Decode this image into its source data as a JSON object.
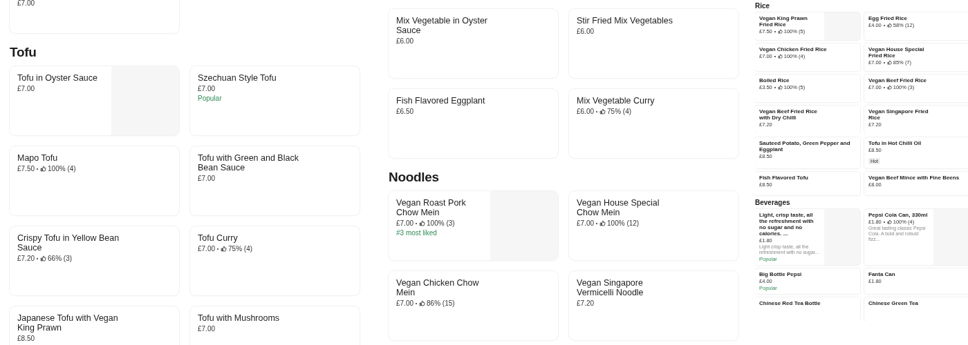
{
  "panels": [
    {
      "kind": "large",
      "scrolled": true,
      "sections": [
        {
          "items": [
            {
              "price": "£7.00"
            }
          ]
        },
        {
          "heading": "Tofu",
          "items": [
            {
              "name": "Tofu in Oyster Sauce",
              "price": "£7.00",
              "image": true
            },
            {
              "name": "Szechuan Style Tofu",
              "price": "£7.00",
              "tag": {
                "text": "Popular",
                "kind": "label"
              }
            },
            {
              "name": "Mapo Tofu",
              "price": "£7.50",
              "rating": "100% (4)"
            },
            {
              "name": "Tofu with Green and Black Bean Sauce",
              "price": "£7.00"
            },
            {
              "name": "Crispy Tofu in Yellow Bean Sauce",
              "price": "£7.20",
              "rating": "66% (3)"
            },
            {
              "name": "Tofu Curry",
              "price": "£7.00",
              "rating": "75% (4)"
            },
            {
              "name": "Japanese Tofu with Vegan King Prawn",
              "price": "£8.50"
            },
            {
              "name": "Tofu with Mushrooms",
              "price": "£7.00"
            }
          ]
        }
      ]
    },
    {
      "kind": "large",
      "sections": [
        {
          "items": [
            {
              "name": "Mix Vegetable in Oyster Sauce",
              "price": "£6.00"
            },
            {
              "name": "Stir Fried Mix Vegetables",
              "price": "£6.00"
            },
            {
              "name": "Fish Flavored Eggplant",
              "price": "£6.50"
            },
            {
              "name": "Mix Vegetable Curry",
              "price": "£6.00",
              "rating": "75% (4)"
            }
          ]
        },
        {
          "heading": "Noodles",
          "items": [
            {
              "name": "Vegan Roast Pork Chow Mein",
              "price": "£7.00",
              "rating": "100% (3)",
              "tag": {
                "text": "#3 most liked",
                "kind": "label"
              },
              "image": true
            },
            {
              "name": "Vegan House Special Chow Mein",
              "price": "£7.00",
              "rating": "100% (12)"
            },
            {
              "name": "Vegan Chicken Chow Mein",
              "price": "£7.00",
              "rating": "86% (15)"
            },
            {
              "name": "Vegan Singapore Vermicelli Noodle",
              "price": "£7.20"
            }
          ]
        }
      ]
    },
    {
      "kind": "small",
      "sections": [
        {
          "heading": "Rice",
          "items": [
            {
              "name": "Vegan King Prawn Fried Rice",
              "price": "£7.50",
              "rating": "100% (5)",
              "image": true
            },
            {
              "name": "Egg Fried Rice",
              "price": "£4.00",
              "rating": "58% (12)"
            },
            {
              "name": "Vegan Chicken Fried Rice",
              "price": "£7.00",
              "rating": "100% (4)"
            },
            {
              "name": "Vegan House Special Fried Rice",
              "price": "£7.00",
              "rating": "85% (7)"
            },
            {
              "name": "Boiled Rice",
              "price": "£3.50",
              "rating": "100% (5)"
            },
            {
              "name": "Vegan Beef Fried Rice",
              "price": "£7.00",
              "rating": "100% (3)"
            },
            {
              "name": "Vegan Beef Fried Rice with Dry Chilli",
              "price": "£7.20"
            },
            {
              "name": "Vegan Singapore Fried Rice",
              "price": "£7.20"
            }
          ]
        }
      ]
    },
    {
      "kind": "tiny",
      "sections": [
        {
          "items": [
            {
              "name": "Sauteed Potato, Green Pepper and Eggplant",
              "price": "£8.50"
            },
            {
              "name": "Tofu in Hot Chilli Oil",
              "price": "£8.50",
              "tag": {
                "text": "Hot",
                "kind": "badge"
              }
            },
            {
              "name": "Fish Flavored Tofu",
              "price": "£8.50"
            },
            {
              "name": "Vegan Beef Mince with Fine Beens",
              "price": "£8.00"
            }
          ]
        },
        {
          "heading": "Beverages",
          "items": [
            {
              "name": "Light, crisp taste, all the refreshment with no sugar and no calories. ...",
              "price": "£1.80",
              "description": "Light crisp taste, all the refreshment with no sugar...",
              "tag": {
                "text": "Popular",
                "kind": "label"
              },
              "image": true
            },
            {
              "name": "Pepsi Cola Can, 330ml",
              "price": "£1.80",
              "rating": "100% (4)",
              "description": "Great tasting classic Pepsi Cola. A bold and robust fizz...",
              "image": true
            },
            {
              "name": "Big Bottle Pepsi",
              "price": "£4.00",
              "tag": {
                "text": "Popular",
                "kind": "label"
              }
            },
            {
              "name": "Fanta Can",
              "price": "£1.80"
            },
            {
              "name": "Chinese Red Tea Bottle"
            },
            {
              "name": "Chinese Green Tea"
            }
          ]
        }
      ]
    }
  ]
}
